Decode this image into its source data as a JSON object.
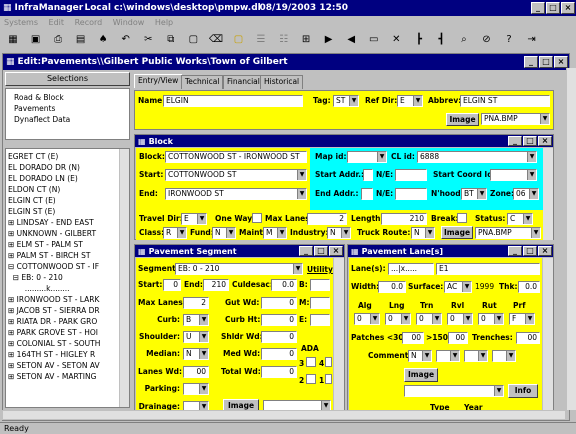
{
  "app": {
    "title": "InfraManager",
    "path": "Local c:\\windows\\desktop\\pmpw.db",
    "datetime": "08/19/2003 12:50"
  },
  "menu": [
    "Systems",
    "Edit",
    "Record",
    "Window",
    "Help"
  ],
  "child": {
    "title": "Edit:Pavements\\\\Gilbert Public Works\\Town of Gilbert"
  },
  "selections": {
    "header": "Selections",
    "items": [
      "Road & Block",
      "Pavements",
      "Dynaflect Data"
    ]
  },
  "tree": [
    "EGRET CT (E)",
    "EL DORADO DR (N)",
    "EL DORADO LN (E)",
    "ELDON CT (N)",
    "ELGIN CT (E)",
    "ELGIN ST (E)",
    "⊞ LINDSAY - END EAST",
    "⊞ UNKNOWN - GILBERT",
    "⊞ ELM ST - PALM ST",
    "⊞ PALM ST - BIRCH ST",
    "⊟ COTTONWOOD ST - IF",
    "  ⊟ EB: 0 - 210",
    "       .........k........",
    "⊞ IRONWOOD ST - LARK",
    "⊞ JACOB ST - SIERRA DR",
    "⊞ RIATA DR - PARK GRO",
    "⊞ PARK GROVE ST - HOI",
    "⊞ COLONIAL ST - SOUTH",
    "⊞ 164TH ST - HIGLEY R",
    "⊞ SETON AV - SETON AV",
    "⊞ SETON AV - MARTING"
  ],
  "tabs": [
    "Entry/View",
    "Technical",
    "Financial",
    "Historical"
  ],
  "street": {
    "name_label": "Name:",
    "name": "ELGIN",
    "tag_label": "Tag:",
    "tag": "ST",
    "refdir_label": "Ref Dir:",
    "refdir": "E",
    "abbrev_label": "Abbrev:",
    "abbrev": "ELGIN ST",
    "image_btn": "Image",
    "image_file": "PNA.BMP"
  },
  "block": {
    "title": "Block",
    "block_label": "Block:",
    "block": "COTTONWOOD ST - IRONWOOD ST",
    "mapid_label": "Map id:",
    "mapid": "",
    "clid_label": "CL id:",
    "clid": "6888",
    "start_label": "Start:",
    "start": "COTTONWOOD ST",
    "startaddr_label": "Start Addr.:",
    "ne1": "N/E:",
    "startcoord_label": "Start Coord Id:",
    "end_label": "End:",
    "end": "IRONWOOD ST",
    "endaddr_label": "End Addr.:",
    "ne2": "N/E:",
    "nhood_label": "N'hood:",
    "nhood": "BT",
    "zone_label": "Zone:",
    "zone": "06",
    "travel_label": "Travel Dir:",
    "travel": "E",
    "oneway_label": "One Way:",
    "maxlanes_label": "Max Lanes:",
    "maxlanes": "2",
    "length_label": "Length:",
    "length": "210",
    "break_label": "Break:",
    "status_label": "Status:",
    "status": "C",
    "class_label": "Class:",
    "class": "R",
    "fund_label": "Fund:",
    "fund": "N",
    "maint_label": "Maint:",
    "maint": "M",
    "industry_label": "Industry:",
    "industry": "N",
    "truck_label": "Truck Route:",
    "truck": "N",
    "image_btn": "Image",
    "image_file": "PNA.BMP"
  },
  "segment": {
    "title": "Pavement Segment",
    "seg_label": "Segment:",
    "seg": "EB: 0 - 210",
    "utility_label": "Utility",
    "start_label": "Start:",
    "start": "0",
    "end_label": "End:",
    "end": "210",
    "culdesac_label": "Culdesac:",
    "culdesac": "0.0",
    "b_label": "B:",
    "maxlanes_label": "Max Lanes:",
    "maxlanes": "2",
    "gutwd_label": "Gut Wd:",
    "gutwd": "0",
    "m_label": "M:",
    "curb_label": "Curb:",
    "curb": "B",
    "curbht_label": "Curb Ht:",
    "curbht": "0",
    "e_label": "E:",
    "shoulder_label": "Shoulder:",
    "shoulder": "U",
    "shldrwd_label": "Shldr Wd:",
    "shldrwd": "0",
    "ada_label": "ADA",
    "median_label": "Median:",
    "median": "N",
    "medwd_label": "Med Wd:",
    "medwd": "0",
    "ada3": "3",
    "ada4": "4",
    "laneswd_label": "Lanes Wd:",
    "laneswd": "00",
    "totalwd_label": "Total Wd:",
    "totalwd": "0",
    "ada2": "2",
    "ada1": "1",
    "parking_label": "Parking:",
    "drainage_label": "Drainage:",
    "image_btn": "Image"
  },
  "lanes": {
    "title": "Pavement Lane[s]",
    "lanes_label": "Lane(s):",
    "lanes": "...|x.....",
    "lanes2": "E1",
    "width_label": "Width:",
    "width": "0.0",
    "surface_label": "Surface:",
    "surface": "AC",
    "year": "1999",
    "thk_label": "Thk:",
    "thk": "0.0",
    "cols": [
      "Alg",
      "Lng",
      "Trn",
      "Rvl",
      "Rut",
      "Prf"
    ],
    "vals": [
      "0",
      "0",
      "0",
      "0",
      "0",
      "F"
    ],
    "patches_label": "Patches <30:",
    "patches": "00",
    ">150": ">150:",
    "p150": "00",
    "trenches_label": "Trenches:",
    "trenches": "00",
    "comment_label": "Comment:",
    "comment": "N",
    "image_btn": "Image",
    "info_btn": "Info",
    "type_label": "Type",
    "year_label": "Year"
  },
  "status": "Ready"
}
